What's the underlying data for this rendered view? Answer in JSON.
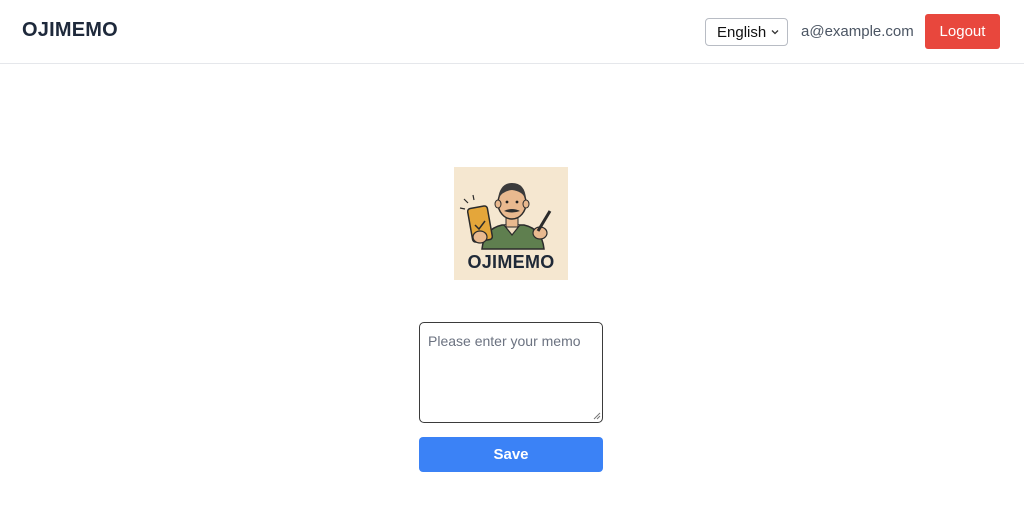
{
  "header": {
    "brand": "OJIMEMO",
    "language": {
      "selected": "English",
      "icon": "chevron-down-icon"
    },
    "user_email": "a@example.com",
    "logout_label": "Logout"
  },
  "logo": {
    "text": "OJIMEMO"
  },
  "memo": {
    "placeholder": "Please enter your memo",
    "value": ""
  },
  "save_label": "Save",
  "colors": {
    "logout": "#e8473d",
    "save": "#3b82f6",
    "logo_bg": "#f5e7d0"
  }
}
